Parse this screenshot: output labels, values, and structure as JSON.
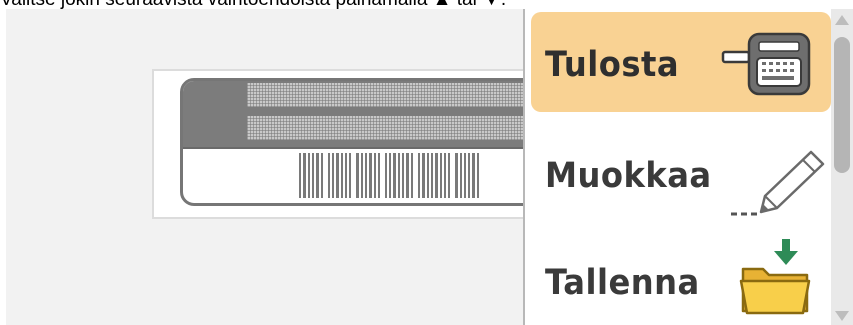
{
  "instruction": "Valitse jokin seuraavista vaihtoehdoista painamalla ▲ tai ▼.",
  "menu": {
    "items": [
      {
        "label": "Tulosta",
        "icon": "printer-icon",
        "selected": true
      },
      {
        "label": "Muokkaa",
        "icon": "pencil-icon",
        "selected": false
      },
      {
        "label": "Tallenna",
        "icon": "folder-save-icon",
        "selected": false
      }
    ]
  },
  "colors": {
    "selected_background": "#f9d293",
    "label_dark": "#7c7c7c",
    "save_arrow": "#2e8b57",
    "folder": "#f5c542"
  }
}
